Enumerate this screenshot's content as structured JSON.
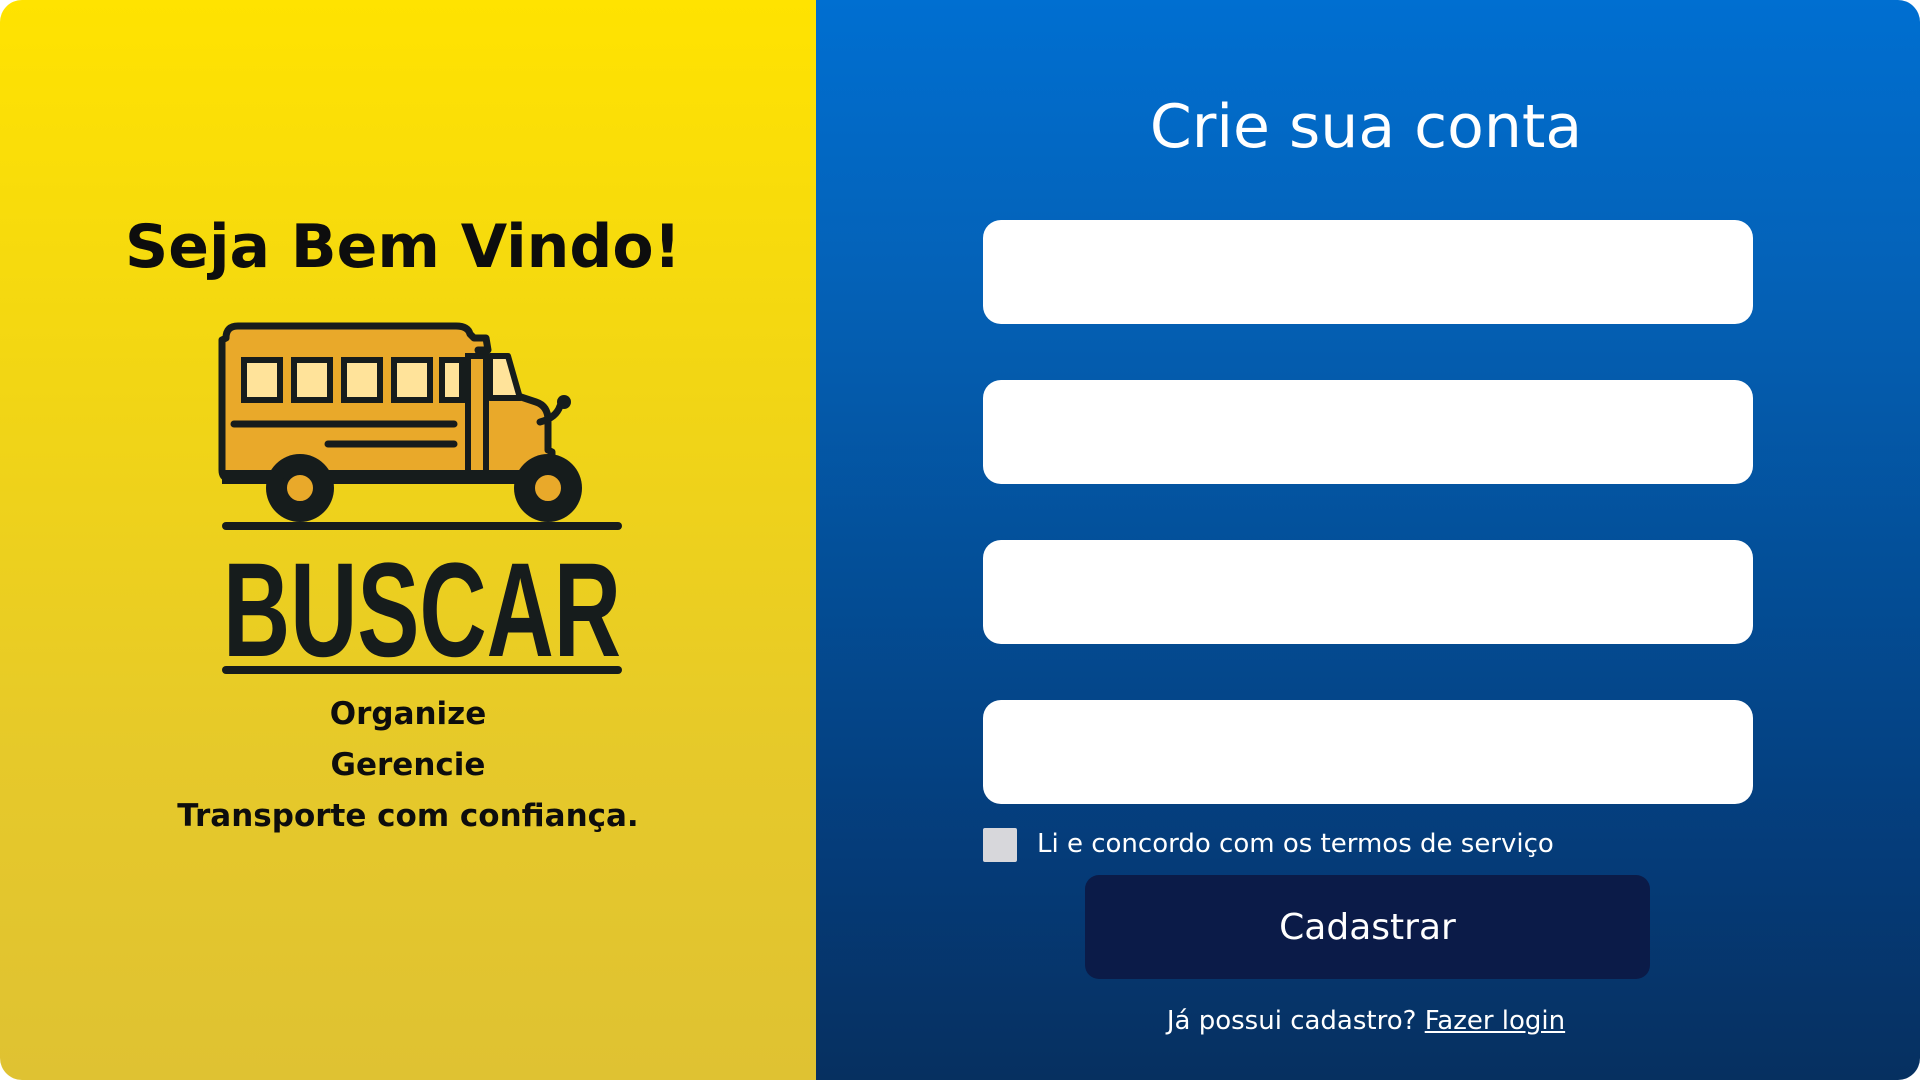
{
  "left_panel": {
    "welcome_title": "Seja Bem Vindo!",
    "logo_text": "BUSCAR",
    "taglines": [
      "Organize",
      "Gerencie",
      "Transporte com confiança."
    ]
  },
  "form": {
    "title": "Crie sua conta",
    "fields": [
      {
        "value": "",
        "placeholder": ""
      },
      {
        "value": "",
        "placeholder": ""
      },
      {
        "value": "",
        "placeholder": ""
      },
      {
        "value": "",
        "placeholder": ""
      }
    ],
    "terms_label": "Li e concordo com os termos de serviço",
    "submit_label": "Cadastrar",
    "login_prompt": "Já possui cadastro?",
    "login_link": "Fazer login"
  },
  "colors": {
    "left_bg": "#ffe300",
    "right_bg": "#0462b8",
    "button_bg": "#0b1b48",
    "bus_yellow": "#e9a92a",
    "ink": "#161c1c"
  },
  "icons": {
    "logo": "school-bus-icon"
  }
}
